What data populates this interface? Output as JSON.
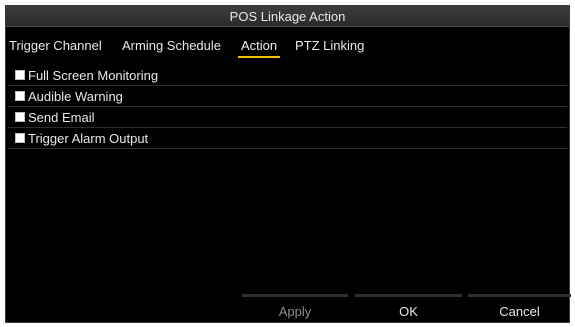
{
  "dialog": {
    "title": "POS Linkage Action"
  },
  "tabs": [
    {
      "label": "Trigger Channel",
      "active": false
    },
    {
      "label": "Arming Schedule",
      "active": false
    },
    {
      "label": "Action",
      "active": true
    },
    {
      "label": "PTZ Linking",
      "active": false
    }
  ],
  "actions": [
    {
      "label": "Full Screen Monitoring",
      "checked": false
    },
    {
      "label": "Audible Warning",
      "checked": false
    },
    {
      "label": "Send Email",
      "checked": false
    },
    {
      "label": "Trigger Alarm Output",
      "checked": false
    }
  ],
  "buttons": {
    "apply": "Apply",
    "ok": "OK",
    "cancel": "Cancel"
  },
  "colors": {
    "background": "#000000",
    "active_tab_underline": "#f2c200",
    "text": "#e8e8e8",
    "disabled_text": "#8c8c8c"
  }
}
